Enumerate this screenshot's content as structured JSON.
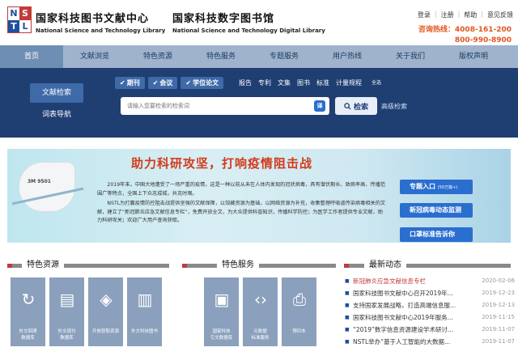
{
  "header": {
    "logo_letters": [
      "N",
      "S",
      "T",
      "L"
    ],
    "org1_cn": "国家科技图书文献中心",
    "org1_en": "National Science and Technology Library",
    "org2_cn": "国家科技数字图书馆",
    "org2_en": "National Science and Technology Digital Library",
    "links": [
      "登录",
      "注册",
      "帮助",
      "意见反馈"
    ],
    "hotline_label": "咨询热线：4008-161-200",
    "hotline_2": "800-990-8900"
  },
  "nav": [
    "首页",
    "文献浏览",
    "特色资源",
    "特色服务",
    "专题服务",
    "用户热线",
    "关于我们",
    "版权声明"
  ],
  "search": {
    "side_tabs": [
      "文献检索",
      "词表导航"
    ],
    "filters": [
      "期刊",
      "会议",
      "学位论文"
    ],
    "types": [
      "报告",
      "专利",
      "文集",
      "图书",
      "标准",
      "计量规程",
      "全选"
    ],
    "placeholder": "请输入您要检索的检索词",
    "translate": "译",
    "button": "检索",
    "advanced": "高级检索"
  },
  "banner": {
    "title": "助力科研攻坚，打响疫情阻击战",
    "mask_label": "3M 9501",
    "para1": "2019年末，中国大地遭受了一场严重的疫情，这是一种以前从未在人体内发现的冠状病毒，具有潜伏期长、致病率高、传播范围广等特点，全国上下众志成城，共克时艰。",
    "para2": "NSTL为打赢疫情防控阻击战提供坚强的文献保障，以馆藏资源为基础，以网络资源为补充，收集整理呼吸道传染病毒相关的文献，建立了“新冠肺炎应急文献信息专栏”，免费开放全文，为大众提供科普知识，传播科学防控；为医学工作者提供专业文献，助力科研攻关；欢迎广大用户查询获取。",
    "btn1": "专题入口",
    "btn1_note": "(50万篇+)",
    "btn2": "新冠病毒动态监测",
    "btn3": "口罩标准告诉你"
  },
  "sections": {
    "resources": "特色资源",
    "services": "特色服务",
    "news": "最新动态"
  },
  "tiles": [
    {
      "icon": "globe-arrow-icon",
      "glyph": "↻",
      "caption": "外文回溯\n数据库"
    },
    {
      "icon": "document-stack-icon",
      "glyph": "▤",
      "caption": "外文现刊\n数据库"
    },
    {
      "icon": "layers-icon",
      "glyph": "◈",
      "caption": "开放获取资源"
    },
    {
      "icon": "book-icon",
      "glyph": "▥",
      "caption": "外文科技图书"
    },
    {
      "icon": "document-search-icon",
      "glyph": "▣",
      "caption": "国家科技\n引文数据库"
    },
    {
      "icon": "code-file-icon",
      "glyph": "‹›",
      "caption": "元数据\n标准服务"
    },
    {
      "icon": "print-icon",
      "glyph": "⎙",
      "caption": "预印本"
    }
  ],
  "news": [
    {
      "title": "新冠肺炎应急文献信息专栏",
      "date": "2020-02-06"
    },
    {
      "title": "国家科技图书文献中心召开2019年...",
      "date": "2019-12-23"
    },
    {
      "title": "支持国家发展战略，打造高端信息服...",
      "date": "2019-12-13"
    },
    {
      "title": "国家科技图书文献中心2019年服务...",
      "date": "2019-11-15"
    },
    {
      "title": "“2019”数字信息资源建设学术研讨...",
      "date": "2019-11-07"
    },
    {
      "title": "NSTL举办“基于人工智能的大数据...",
      "date": "2019-11-07"
    }
  ],
  "colors": {
    "nav_bg": "#9fb4cc",
    "search_bg": "#1f3e72",
    "accent_red": "#c23a3a",
    "hotline": "#e0561f",
    "button_blue": "#2a6ed0",
    "tile_bg": "#8aa0bc"
  }
}
